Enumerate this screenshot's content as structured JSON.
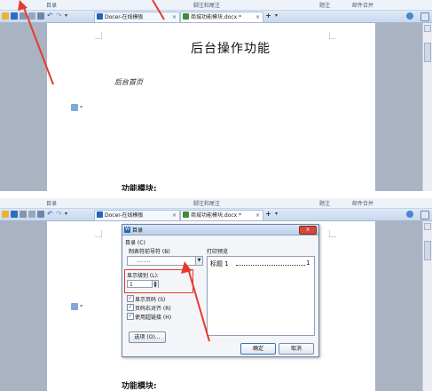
{
  "ribbon_tabs": [
    "目录",
    "脚注和尾注",
    "题注",
    "邮件合并"
  ],
  "tabs": [
    {
      "label": "Docer-在线模板",
      "close": "×"
    },
    {
      "label": "商城功能模块.docx *",
      "close": "×"
    }
  ],
  "add_tab": "+",
  "document": {
    "title": "后台操作功能",
    "line1": "后台首页",
    "heading2": "功能模块:"
  },
  "dialog": {
    "title": "目录",
    "close": "×",
    "group": "目录 (C)",
    "tab_leader_label": "制表符前导符 (B)",
    "tab_leader_value": "........",
    "print_preview_label": "打印预览",
    "preview_entry": "标题 1",
    "preview_page": "1",
    "show_levels_label": "显示级别 (L):",
    "show_levels_value": "1",
    "checkboxes": [
      {
        "label": "显示页码 (S)",
        "checked": true
      },
      {
        "label": "页码右对齐 (R)",
        "checked": true
      },
      {
        "label": "使用超链接 (H)",
        "checked": true
      }
    ],
    "options_button": "选项 (O)...",
    "ok_button": "确定",
    "cancel_button": "取消"
  },
  "colors": {
    "annotation_arrow": "#e63a2e",
    "highlight": "#e33b34"
  },
  "icons": [
    "open-folder-icon",
    "save-icon",
    "print-icon",
    "print-preview-icon",
    "undo-icon",
    "redo-icon",
    "dropdown-icon",
    "docer-icon",
    "wps-doc-icon"
  ]
}
